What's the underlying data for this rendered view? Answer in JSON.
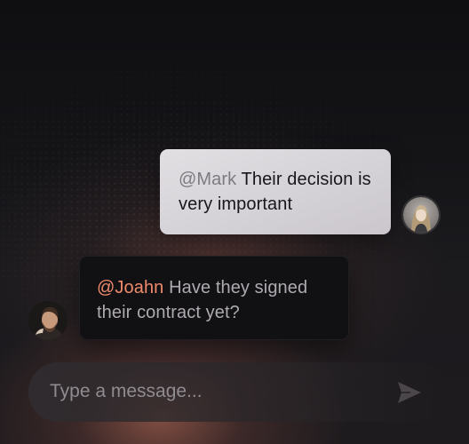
{
  "messages": [
    {
      "mention": "@Mark",
      "text": "Their decision is very important",
      "side": "right",
      "avatar_icon": "woman-avatar"
    },
    {
      "mention": "@Joahn",
      "text": "Have they signed their contract yet?",
      "side": "left",
      "avatar_icon": "man-avatar"
    }
  ],
  "composer": {
    "placeholder": "Type a message...",
    "value": "",
    "send_icon": "send-icon"
  },
  "colors": {
    "mention_light": "#7d7a80",
    "mention_accent": "#ef8a6c",
    "bubble_light": "#dcd9dd",
    "bubble_dark": "#111114"
  }
}
